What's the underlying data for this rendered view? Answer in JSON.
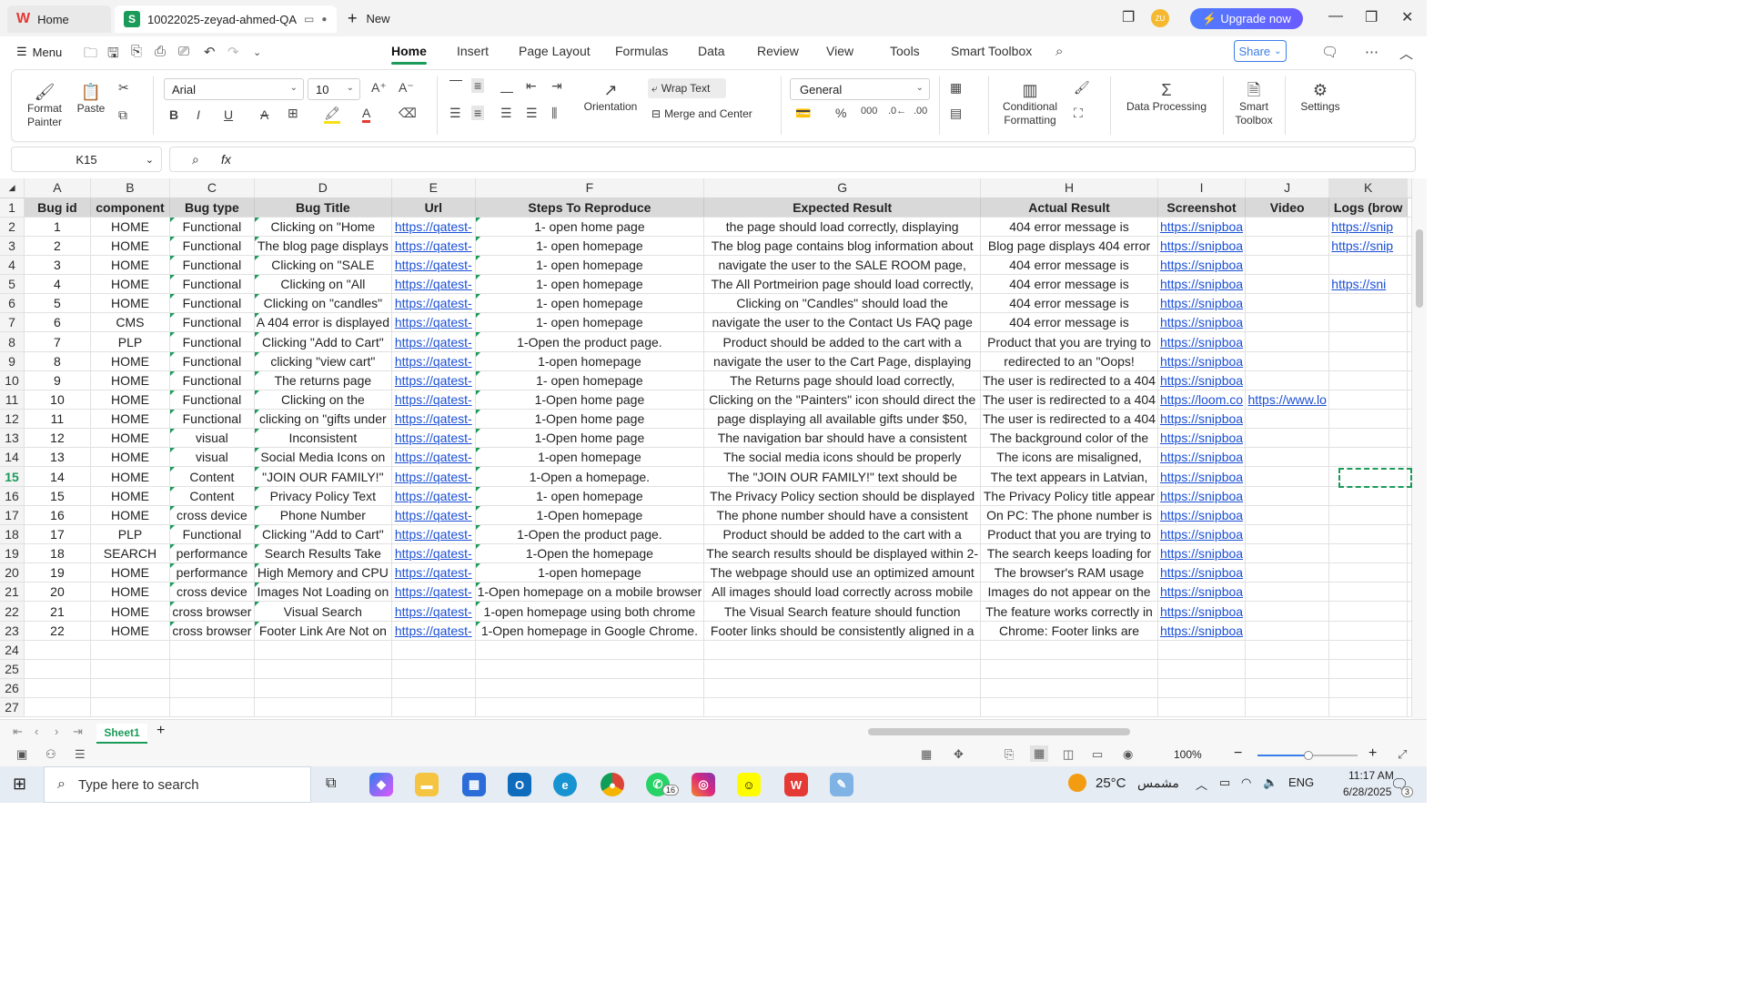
{
  "titlebar": {
    "home_tab": "Home",
    "doc_tab": "10022025-zeyad-ahmed-QA",
    "new_tab": "New",
    "upgrade": "Upgrade now",
    "avatar": "ZU"
  },
  "menubar": {
    "menu": "Menu",
    "tabs": [
      "Home",
      "Insert",
      "Page Layout",
      "Formulas",
      "Data",
      "Review",
      "View",
      "Tools",
      "Smart Toolbox"
    ],
    "share": "Share"
  },
  "ribbon": {
    "format_painter": "Format Painter",
    "paste": "Paste",
    "font_name": "Arial",
    "font_size": "10",
    "wrap_text": "Wrap Text",
    "orientation": "Orientation",
    "merge_center": "Merge and Center",
    "number_format": "General",
    "conditional_formatting": "Conditional Formatting",
    "data_processing": "Data Processing",
    "smart_toolbox": "Smart Toolbox",
    "settings": "Settings"
  },
  "formula": {
    "cell_ref": "K15",
    "fx": "fx",
    "value": ""
  },
  "columns": [
    "A",
    "B",
    "C",
    "D",
    "E",
    "F",
    "G",
    "H",
    "I",
    "J",
    "K"
  ],
  "headers": [
    "Bug id",
    "component",
    "Bug type",
    "Bug Title",
    "Url",
    "Steps To Reproduce",
    "Expected Result",
    "Actual Result",
    "Screenshot",
    "Video",
    "Logs (brow"
  ],
  "rows": [
    [
      "1",
      "HOME",
      "Functional",
      "Clicking on \"Home",
      "https://qatest-",
      "1- open home page",
      "the page should load correctly, displaying",
      "404 error message is",
      "https://snipboa",
      "",
      "https://snip"
    ],
    [
      "2",
      "HOME",
      "Functional",
      "The blog page displays",
      "https://qatest-",
      "1- open homepage",
      "The blog page contains blog information about",
      "Blog page displays 404 error",
      "https://snipboa",
      "",
      "https://snip"
    ],
    [
      "3",
      "HOME",
      "Functional",
      "Clicking on \"SALE",
      "https://qatest-",
      "1- open homepage",
      "navigate the user to the SALE ROOM page,",
      "404 error message is",
      "https://snipboa",
      "",
      ""
    ],
    [
      "4",
      "HOME",
      "Functional",
      "Clicking on \"All",
      "https://qatest-",
      "1- open homepage",
      "The All Portmeirion page should load correctly,",
      "404 error message is",
      "https://snipboa",
      "",
      "https://sni"
    ],
    [
      "5",
      "HOME",
      "Functional",
      "Clicking on \"candles\"",
      "https://qatest-",
      "1- open homepage",
      "Clicking on \"Candles\" should load the",
      "404 error message is",
      "https://snipboa",
      "",
      ""
    ],
    [
      "6",
      "CMS",
      "Functional",
      "A 404 error is displayed",
      "https://qatest-",
      "1- open homepage",
      "navigate the user to the Contact Us FAQ page",
      "404 error message is",
      "https://snipboa",
      "",
      ""
    ],
    [
      "7",
      "PLP",
      "Functional",
      "Clicking \"Add to Cart\"",
      "https://qatest-",
      "1-Open the product page.",
      "Product should be added to the cart with a",
      "Product that you are trying to",
      "https://snipboa",
      "",
      ""
    ],
    [
      "8",
      "HOME",
      "Functional",
      "clicking \"view cart\"",
      "https://qatest-",
      "1-open homepage",
      "navigate the user to the Cart Page, displaying",
      "redirected to an \"Oops!",
      "https://snipboa",
      "",
      ""
    ],
    [
      "9",
      "HOME",
      "Functional",
      "The returns page",
      "https://qatest-",
      "1- open homepage",
      "The Returns page should load correctly,",
      "The user is redirected to a 404",
      "https://snipboa",
      "",
      ""
    ],
    [
      "10",
      "HOME",
      "Functional",
      "Clicking on the",
      "https://qatest-",
      "1-Open home page",
      "Clicking on the \"Painters\" icon should direct the",
      "The user is redirected to a 404",
      "https://loom.co",
      "https://www.lo",
      ""
    ],
    [
      "11",
      "HOME",
      "Functional",
      "clicking on \"gifts under",
      "https://qatest-",
      "1-Open home page",
      "page displaying all available gifts under $50,",
      "The user is redirected to a 404",
      "https://snipboa",
      "",
      ""
    ],
    [
      "12",
      "HOME",
      "visual",
      "Inconsistent",
      "https://qatest-",
      "1-Open home page",
      "The navigation bar should have a consistent",
      "The background color of the",
      "https://snipboa",
      "",
      ""
    ],
    [
      "13",
      "HOME",
      "visual",
      "Social Media Icons on",
      "https://qatest-",
      "1-open homepage",
      "The social media icons should be properly",
      "The icons are misaligned,",
      "https://snipboa",
      "",
      ""
    ],
    [
      "14",
      "HOME",
      "Content",
      "\"JOIN OUR FAMILY!\"",
      "https://qatest-",
      "1-Open a homepage.",
      "The \"JOIN OUR FAMILY!\" text should be",
      "The text appears in Latvian,",
      "https://snipboa",
      "",
      ""
    ],
    [
      "15",
      "HOME",
      "Content",
      "Privacy Policy Text",
      "https://qatest-",
      "1- open homepage",
      "The Privacy Policy section should be displayed",
      "The Privacy Policy title appear",
      "https://snipboa",
      "",
      ""
    ],
    [
      "16",
      "HOME",
      "cross device",
      "Phone Number",
      "https://qatest-",
      "1-Open homepage",
      "The phone number should have a consistent",
      "On PC: The phone number is",
      "https://snipboa",
      "",
      ""
    ],
    [
      "17",
      "PLP",
      "Functional",
      "Clicking \"Add to Cart\"",
      "https://qatest-",
      "1-Open the product page.",
      "Product should be added to the cart with a",
      "Product that you are trying to",
      "https://snipboa",
      "",
      ""
    ],
    [
      "18",
      "SEARCH",
      "performance",
      "Search Results Take",
      "https://qatest-",
      "1-Open the homepage",
      "The search results should be displayed within 2-",
      "The search keeps loading for",
      "https://snipboa",
      "",
      ""
    ],
    [
      "19",
      "HOME",
      "performance",
      "High Memory and CPU",
      "https://qatest-",
      "1-open homepage",
      "The webpage should use an optimized amount",
      "The browser's RAM usage",
      "https://snipboa",
      "",
      ""
    ],
    [
      "20",
      "HOME",
      "cross device",
      "Images Not Loading on",
      "https://qatest-",
      "1-Open homepage on a mobile browser",
      "All images should load correctly across mobile",
      "Images do not appear on the",
      "https://snipboa",
      "",
      ""
    ],
    [
      "21",
      "HOME",
      "cross browser",
      "Visual Search",
      "https://qatest-",
      "1-open homepage using both chrome",
      "The Visual Search feature should function",
      "The feature works correctly in",
      "https://snipboa",
      "",
      ""
    ],
    [
      "22",
      "HOME",
      "cross browser",
      "Footer Link Are Not on",
      "https://qatest-",
      "1-Open homepage in Google Chrome.",
      "Footer links should be consistently aligned in a",
      "Chrome: Footer links are",
      "https://snipboa",
      "",
      ""
    ]
  ],
  "row_numbers": [
    "1",
    "2",
    "3",
    "4",
    "5",
    "6",
    "7",
    "8",
    "9",
    "10",
    "11",
    "12",
    "13",
    "14",
    "15",
    "16",
    "17",
    "18",
    "19",
    "20",
    "21",
    "22",
    "23",
    "24",
    "25",
    "26",
    "27"
  ],
  "sheet_tab": "Sheet1",
  "status": {
    "zoom": "100%"
  },
  "taskbar": {
    "search_placeholder": "Type here to search",
    "weather": "25°C",
    "weather_desc": "مشمس",
    "lang": "ENG",
    "time": "11:17 AM",
    "date": "6/28/2025",
    "whatsapp_badge": "16",
    "notif_badge": "3"
  },
  "colors": {
    "accent": "#1a9b5a",
    "link": "#1a4fd6",
    "header_fill": "#d9d9d9"
  }
}
